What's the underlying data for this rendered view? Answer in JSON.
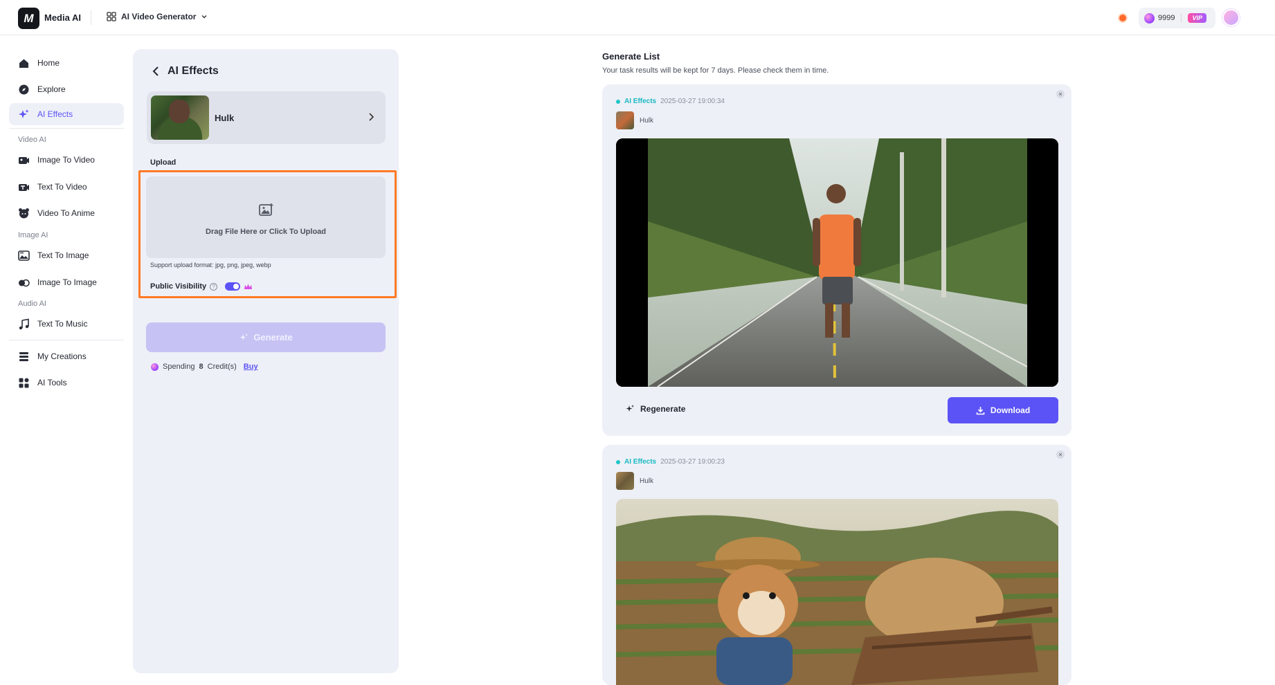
{
  "header": {
    "brand": "Media AI",
    "product": "AI Video Generator",
    "credits": "9999",
    "vip_label": "VIP"
  },
  "sidebar": {
    "items": [
      {
        "label": "Home",
        "icon": "home-icon"
      },
      {
        "label": "Explore",
        "icon": "compass-icon"
      },
      {
        "label": "AI Effects",
        "icon": "sparkle-icon",
        "active": true
      }
    ],
    "sections": [
      {
        "label": "Video AI",
        "items": [
          {
            "label": "Image To Video",
            "icon": "image-video-icon"
          },
          {
            "label": "Text To Video",
            "icon": "text-video-icon"
          },
          {
            "label": "Video To Anime",
            "icon": "anime-icon"
          }
        ]
      },
      {
        "label": "Image AI",
        "items": [
          {
            "label": "Text To Image",
            "icon": "text-image-icon"
          },
          {
            "label": "Image To Image",
            "icon": "image-image-icon"
          }
        ]
      },
      {
        "label": "Audio AI",
        "items": [
          {
            "label": "Text To Music",
            "icon": "music-icon"
          }
        ]
      }
    ],
    "bottom": [
      {
        "label": "My Creations",
        "icon": "layers-icon"
      },
      {
        "label": "AI Tools",
        "icon": "apps-icon"
      }
    ]
  },
  "panel": {
    "title": "AI Effects",
    "effect_name": "Hulk",
    "upload_label": "Upload",
    "drop_text": "Drag File Here or Click To Upload",
    "support_text": "Support upload format: jpg, png, jpeg, webp",
    "visibility_label": "Public Visibility",
    "visibility_on": true,
    "generate_label": "Generate",
    "spend_prefix": "Spending",
    "spend_amount": "8",
    "spend_suffix": "Credit(s)",
    "buy_label": "Buy"
  },
  "generate_list": {
    "title": "Generate List",
    "subtitle": "Your task results will be kept for 7 days. Please check them in time.",
    "items": [
      {
        "tag": "AI Effects",
        "timestamp": "2025-03-27 19:00:34",
        "effect": "Hulk",
        "regenerate_label": "Regenerate",
        "download_label": "Download"
      },
      {
        "tag": "AI Effects",
        "timestamp": "2025-03-27 19:00:23",
        "effect": "Hulk"
      }
    ]
  },
  "colors": {
    "accent": "#5b53f5",
    "highlight": "#ff7a26",
    "tag": "#17b9c2"
  }
}
